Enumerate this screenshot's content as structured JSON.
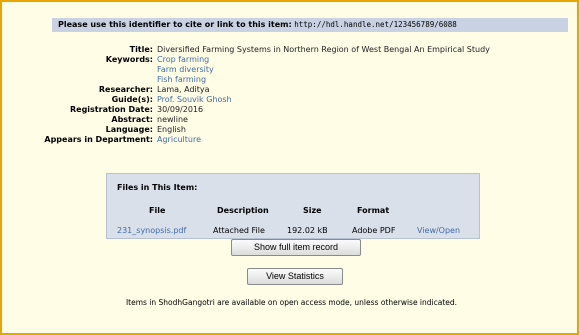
{
  "cite": {
    "label": "Please use this identifier to cite or link to this item:",
    "handle": "http://hdl.handle.net/123456789/6088"
  },
  "metadata": {
    "title_key": "Title:",
    "title_value": "Diversified Farming Systems in Northern Region of West Bengal An Empirical Study",
    "keywords_key": "Keywords:",
    "keywords": [
      "Crop farming",
      "Farm diversity",
      "Fish farming"
    ],
    "researcher_key": "Researcher:",
    "researcher_value": "Lama, Aditya",
    "guide_key": "Guide(s):",
    "guide_value": "Prof. Souvik Ghosh",
    "regdate_key": "Registration Date:",
    "regdate_value": "30/09/2016",
    "abstract_key": "Abstract:",
    "abstract_value": "newline",
    "language_key": "Language:",
    "language_value": "English",
    "department_key": "Appears in Department:",
    "department_value": "Agriculture"
  },
  "files": {
    "title": "Files in This Item:",
    "headers": {
      "file": "File",
      "description": "Description",
      "size": "Size",
      "format": "Format"
    },
    "row": {
      "file": "231_synopsis.pdf",
      "description": "Attached File",
      "size": "192.02 kB",
      "format": "Adobe PDF",
      "action": "View/Open"
    }
  },
  "buttons": {
    "full_record": "Show full item record",
    "statistics": "View Statistics"
  },
  "footer": "Items in ShodhGangotri are available on open access mode, unless otherwise indicated.",
  "colors": {
    "frame_border": "#e8a400",
    "background": "#fffde6",
    "link": "#3f6ca6",
    "cite_bar": "#c9d2e3",
    "files_panel": "#d9e0ea"
  }
}
